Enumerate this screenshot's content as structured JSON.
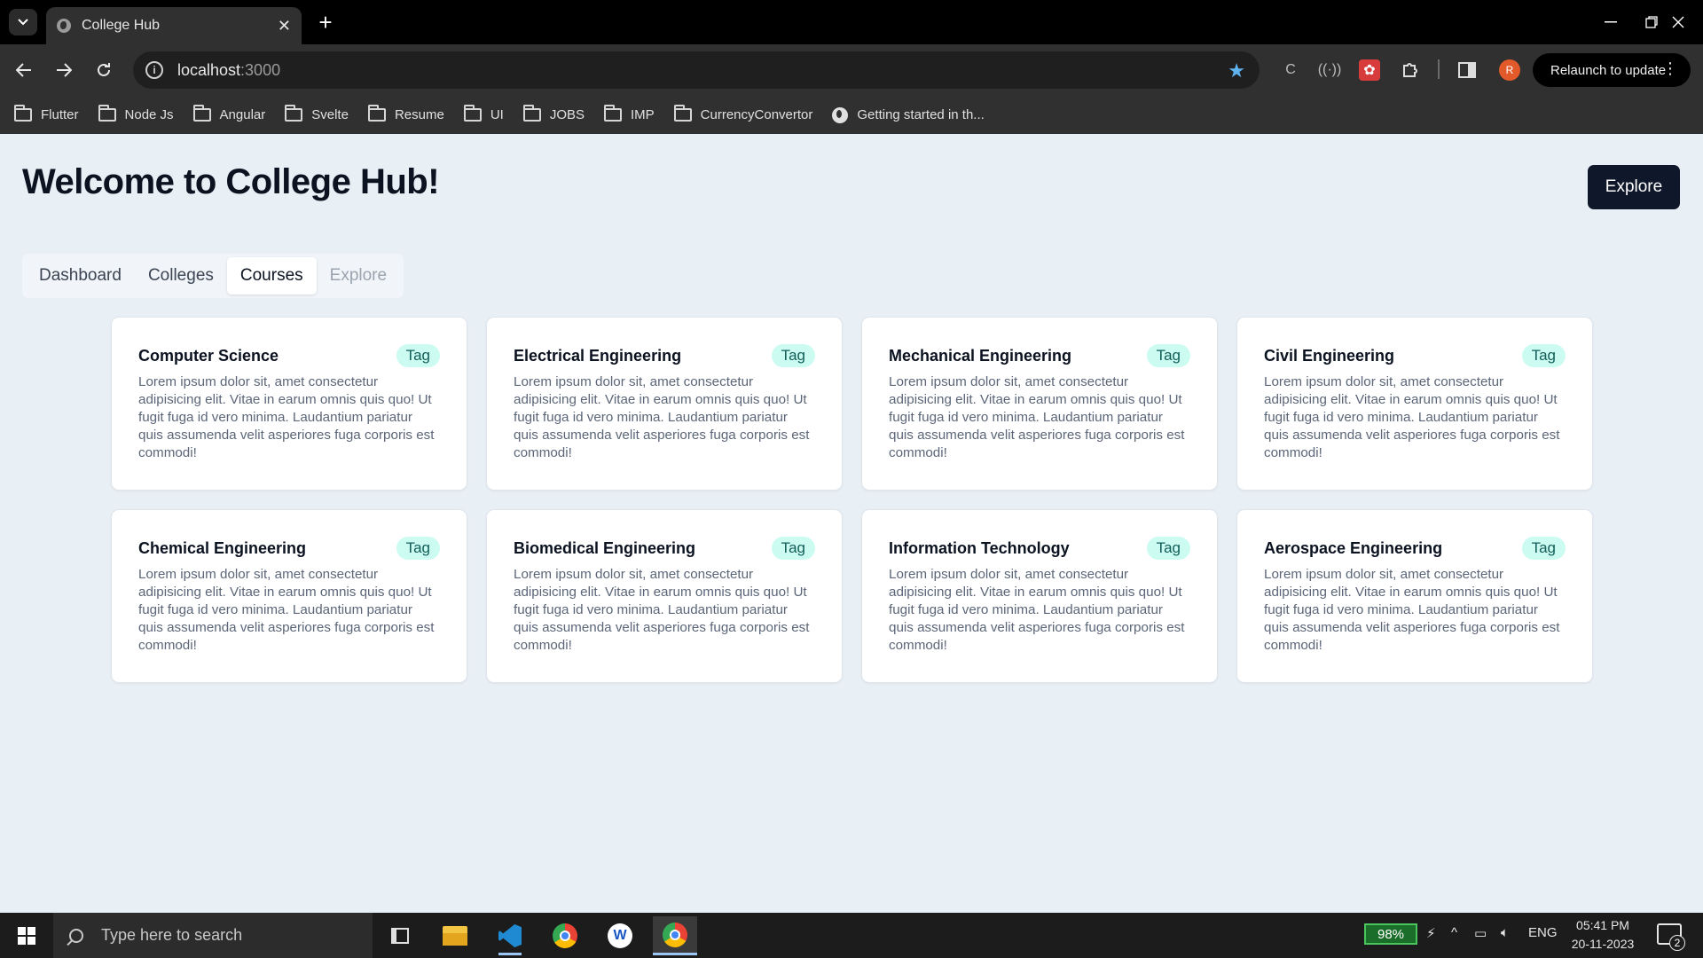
{
  "browser": {
    "tab_title": "College Hub",
    "tab_close": "✕",
    "new_tab": "+",
    "url_host": "localhost",
    "url_port": ":3000",
    "relaunch_label": "Relaunch to update",
    "profile_initial": "R",
    "bookmarks": [
      {
        "label": "Flutter",
        "icon": "folder-icon"
      },
      {
        "label": "Node Js",
        "icon": "folder-icon"
      },
      {
        "label": "Angular",
        "icon": "folder-icon"
      },
      {
        "label": "Svelte",
        "icon": "folder-icon"
      },
      {
        "label": "Resume",
        "icon": "folder-icon"
      },
      {
        "label": "UI",
        "icon": "folder-icon"
      },
      {
        "label": "JOBS",
        "icon": "folder-icon"
      },
      {
        "label": "IMP",
        "icon": "folder-icon"
      },
      {
        "label": "CurrencyConvertor",
        "icon": "folder-icon"
      },
      {
        "label": "Getting started in th...",
        "icon": "globe-icon"
      }
    ]
  },
  "page": {
    "title": "Welcome to College Hub!",
    "explore_button": "Explore",
    "tabs": [
      {
        "label": "Dashboard",
        "state": "normal"
      },
      {
        "label": "Colleges",
        "state": "normal"
      },
      {
        "label": "Courses",
        "state": "active"
      },
      {
        "label": "Explore",
        "state": "disabled"
      }
    ],
    "cards": [
      {
        "title": "Computer Science",
        "tag": "Tag",
        "description": "Lorem ipsum dolor sit, amet consectetur adipisicing elit. Vitae in earum omnis quis quo! Ut fugit fuga id vero minima. Laudantium pariatur quis assumenda velit asperiores fuga corporis est commodi!"
      },
      {
        "title": "Electrical Engineering",
        "tag": "Tag",
        "description": "Lorem ipsum dolor sit, amet consectetur adipisicing elit. Vitae in earum omnis quis quo! Ut fugit fuga id vero minima. Laudantium pariatur quis assumenda velit asperiores fuga corporis est commodi!"
      },
      {
        "title": "Mechanical Engineering",
        "tag": "Tag",
        "description": "Lorem ipsum dolor sit, amet consectetur adipisicing elit. Vitae in earum omnis quis quo! Ut fugit fuga id vero minima. Laudantium pariatur quis assumenda velit asperiores fuga corporis est commodi!"
      },
      {
        "title": "Civil Engineering",
        "tag": "Tag",
        "description": "Lorem ipsum dolor sit, amet consectetur adipisicing elit. Vitae in earum omnis quis quo! Ut fugit fuga id vero minima. Laudantium pariatur quis assumenda velit asperiores fuga corporis est commodi!"
      },
      {
        "title": "Chemical Engineering",
        "tag": "Tag",
        "description": "Lorem ipsum dolor sit, amet consectetur adipisicing elit. Vitae in earum omnis quis quo! Ut fugit fuga id vero minima. Laudantium pariatur quis assumenda velit asperiores fuga corporis est commodi!"
      },
      {
        "title": "Biomedical Engineering",
        "tag": "Tag",
        "description": "Lorem ipsum dolor sit, amet consectetur adipisicing elit. Vitae in earum omnis quis quo! Ut fugit fuga id vero minima. Laudantium pariatur quis assumenda velit asperiores fuga corporis est commodi!"
      },
      {
        "title": "Information Technology",
        "tag": "Tag",
        "description": "Lorem ipsum dolor sit, amet consectetur adipisicing elit. Vitae in earum omnis quis quo! Ut fugit fuga id vero minima. Laudantium pariatur quis assumenda velit asperiores fuga corporis est commodi!"
      },
      {
        "title": "Aerospace Engineering",
        "tag": "Tag",
        "description": "Lorem ipsum dolor sit, amet consectetur adipisicing elit. Vitae in earum omnis quis quo! Ut fugit fuga id vero minima. Laudantium pariatur quis assumenda velit asperiores fuga corporis est commodi!"
      }
    ]
  },
  "taskbar": {
    "search_placeholder": "Type here to search",
    "battery": "98%",
    "language": "ENG",
    "time": "05:41 PM",
    "date": "20-11-2023",
    "notifications": "2",
    "apps": [
      "task-view-icon",
      "file-explorer-icon",
      "vscode-icon",
      "chrome-icon",
      "w-app-icon",
      "chrome-profile-icon"
    ]
  },
  "colors": {
    "page_bg": "#e8eff5",
    "primary_button": "#0f172a",
    "tag_bg": "#ccfbf1",
    "tag_text": "#115e59",
    "bookmark_star": "#5fb4f0",
    "profile": "#e25a29"
  }
}
